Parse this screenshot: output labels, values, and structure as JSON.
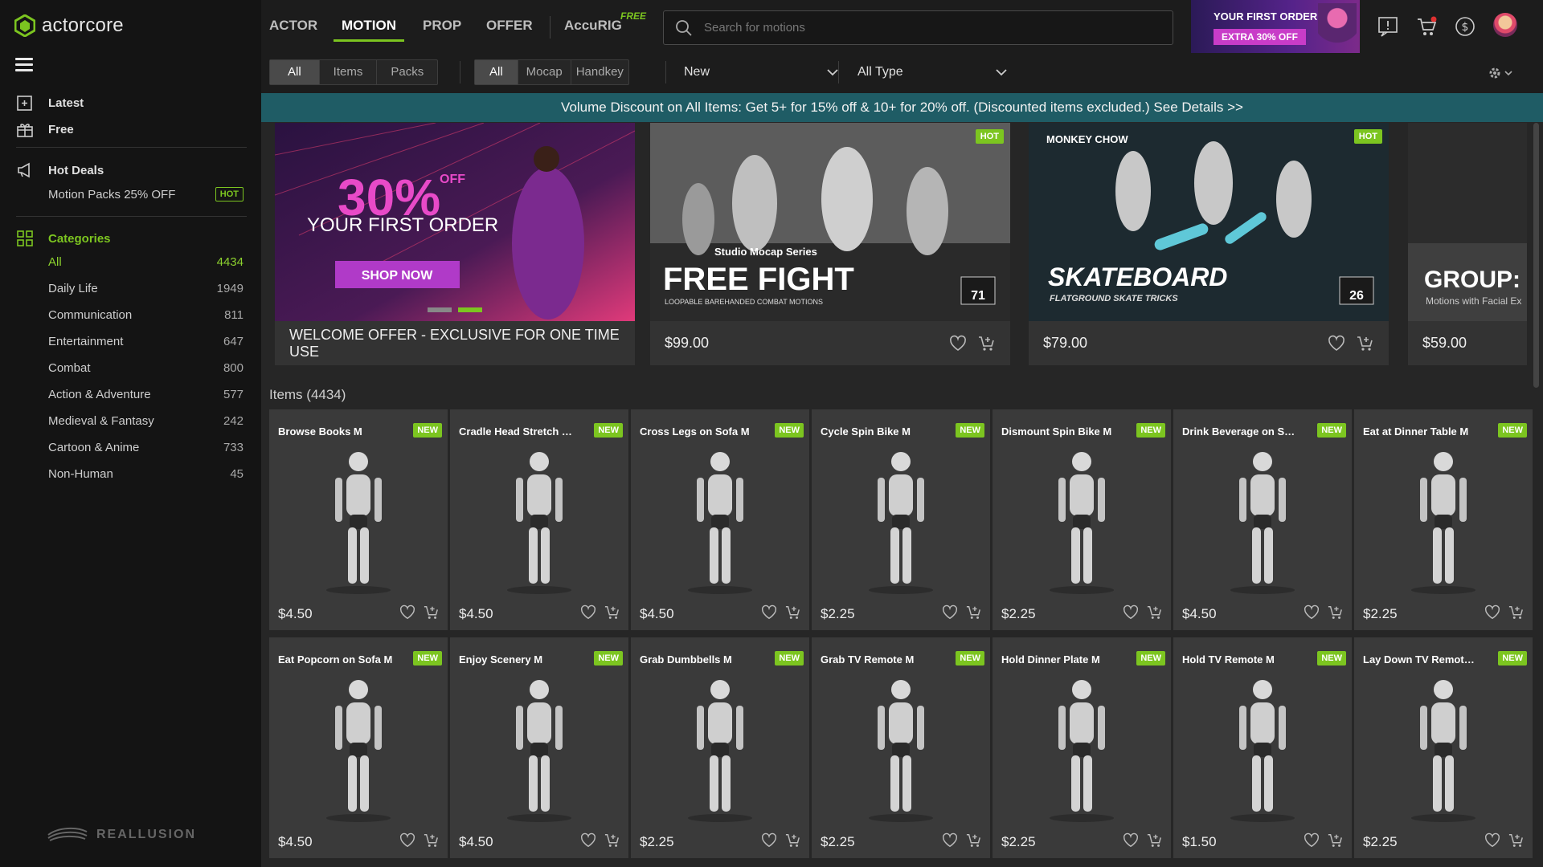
{
  "app": {
    "logo_text": "actorcore"
  },
  "sidebar": {
    "latest": "Latest",
    "free": "Free",
    "hot_deals": "Hot Deals",
    "deal_item": "Motion Packs 25% OFF",
    "deal_badge": "HOT",
    "categories_title": "Categories",
    "categories": [
      {
        "label": "All",
        "count": "4434"
      },
      {
        "label": "Daily Life",
        "count": "1949"
      },
      {
        "label": "Communication",
        "count": "811"
      },
      {
        "label": "Entertainment",
        "count": "647"
      },
      {
        "label": "Combat",
        "count": "800"
      },
      {
        "label": "Action & Adventure",
        "count": "577"
      },
      {
        "label": "Medieval & Fantasy",
        "count": "242"
      },
      {
        "label": "Cartoon & Anime",
        "count": "733"
      },
      {
        "label": "Non-Human",
        "count": "45"
      }
    ],
    "footer_brand": "REALLUSION"
  },
  "topnav": {
    "tabs": [
      "ACTOR",
      "MOTION",
      "PROP",
      "OFFER",
      "AccuRIG"
    ],
    "active_tab": "MOTION",
    "free_tag": "FREE",
    "search_placeholder": "Search for motions",
    "promo_line1": "YOUR FIRST ORDER",
    "promo_line2": "EXTRA 30% OFF"
  },
  "filters": {
    "group1": [
      "All",
      "Items",
      "Packs"
    ],
    "group2": [
      "All",
      "Mocap",
      "Handkey"
    ],
    "sort": "New",
    "type": "All Type"
  },
  "banner": "Volume Discount on All Items: Get 5+ for 15% off & 10+ for 20% off. (Discounted items excluded.) See Details >>",
  "featured": [
    {
      "headline": "30%",
      "off": "OFF",
      "sub": "YOUR FIRST ORDER",
      "cta": "SHOP NOW",
      "footer": "WELCOME OFFER - EXCLUSIVE FOR ONE TIME USE"
    },
    {
      "badge": "HOT",
      "series": "Studio Mocap Series",
      "title": "FREE FIGHT",
      "tagline": "LOOPABLE BAREHANDED COMBAT MOTIONS",
      "count": "71",
      "price": "$99.00"
    },
    {
      "badge": "HOT",
      "brand": "MONKEY CHOW",
      "title": "SKATEBOARD",
      "tagline": "FLATGROUND SKATE TRICKS",
      "count": "26",
      "price": "$79.00"
    },
    {
      "title": "GROUP: S",
      "tagline": "Motions with Facial Ex",
      "price": "$59.00"
    }
  ],
  "items_title": "Items (4434)",
  "items": [
    {
      "name": "Browse Books M",
      "price": "$4.50",
      "badge": "NEW"
    },
    {
      "name": "Cradle Head Stretch on Sofa M",
      "price": "$4.50",
      "badge": "NEW"
    },
    {
      "name": "Cross Legs on Sofa M",
      "price": "$4.50",
      "badge": "NEW"
    },
    {
      "name": "Cycle Spin Bike M",
      "price": "$2.25",
      "badge": "NEW"
    },
    {
      "name": "Dismount Spin Bike M",
      "price": "$2.25",
      "badge": "NEW"
    },
    {
      "name": "Drink Beverage on Sofa M",
      "price": "$4.50",
      "badge": "NEW"
    },
    {
      "name": "Eat at Dinner Table M",
      "price": "$2.25",
      "badge": "NEW"
    },
    {
      "name": "Eat Popcorn on Sofa M",
      "price": "$4.50",
      "badge": "NEW"
    },
    {
      "name": "Enjoy Scenery M",
      "price": "$4.50",
      "badge": "NEW"
    },
    {
      "name": "Grab Dumbbells M",
      "price": "$2.25",
      "badge": "NEW"
    },
    {
      "name": "Grab TV Remote M",
      "price": "$2.25",
      "badge": "NEW"
    },
    {
      "name": "Hold Dinner Plate M",
      "price": "$2.25",
      "badge": "NEW"
    },
    {
      "name": "Hold TV Remote M",
      "price": "$1.50",
      "badge": "NEW"
    },
    {
      "name": "Lay Down TV Remote M",
      "price": "$2.25",
      "badge": "NEW"
    }
  ],
  "colors": {
    "accent": "#7cc520",
    "banner": "#1f5c65",
    "promo": "#c83cc8"
  }
}
